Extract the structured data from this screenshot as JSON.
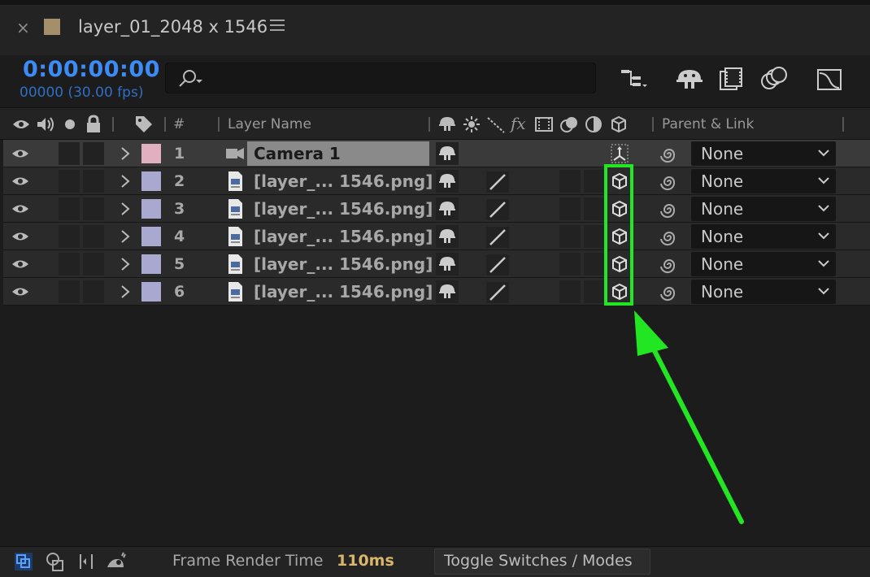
{
  "tab": {
    "close": "×",
    "title": "layer_01_2048 x 1546"
  },
  "timecode": {
    "value": "0:00:00:00",
    "frames": "00000 (30.00 fps)"
  },
  "search": {
    "value": ""
  },
  "header": {
    "number": "#",
    "layer_name": "Layer Name",
    "fx": "fx",
    "parent_link": "Parent & Link"
  },
  "layers": [
    {
      "num": "1",
      "name": "Camera 1",
      "type": "camera",
      "color": "#e0b0c0",
      "parent": "None"
    },
    {
      "num": "2",
      "name": "[layer_... 1546.png]",
      "type": "image",
      "color": "#a8a8d0",
      "parent": "None"
    },
    {
      "num": "3",
      "name": "[layer_... 1546.png]",
      "type": "image",
      "color": "#a8a8d0",
      "parent": "None"
    },
    {
      "num": "4",
      "name": "[layer_... 1546.png]",
      "type": "image",
      "color": "#a8a8d0",
      "parent": "None"
    },
    {
      "num": "5",
      "name": "[layer_... 1546.png]",
      "type": "image",
      "color": "#a8a8d0",
      "parent": "None"
    },
    {
      "num": "6",
      "name": "[layer_... 1546.png]",
      "type": "image",
      "color": "#a8a8d0",
      "parent": "None"
    }
  ],
  "footer": {
    "frame_render_label": "Frame Render Time",
    "frame_render_value": "110ms",
    "toggle_label": "Toggle Switches / Modes"
  },
  "colors": {
    "accent_timecode": "#3d8bf5",
    "highlight": "#22e622",
    "render_time": "#d8b66a",
    "comp_swatch": "#a58f6b"
  },
  "icons": [
    "close-icon",
    "comp-color-swatch",
    "panel-menu-icon",
    "search-icon",
    "composition-flowchart-icon",
    "shy-icon",
    "frame-blending-icon",
    "motion-blur-icon",
    "graph-editor-icon",
    "eye-icon",
    "audio-icon",
    "solo-icon",
    "lock-icon",
    "label-tag-icon",
    "switch-shy-icon",
    "quality-icon",
    "fx-icon",
    "adjustment-icon",
    "3d-layer-icon",
    "camera-icon",
    "image-file-icon",
    "pickwhip-icon",
    "chevron-down-icon",
    "arrow-annotation"
  ]
}
